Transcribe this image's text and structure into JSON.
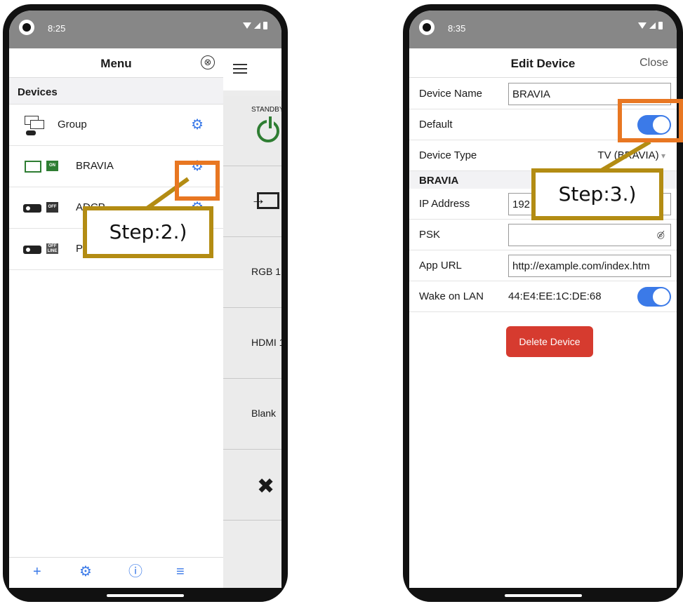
{
  "phone1": {
    "status_time": "8:25",
    "menu": {
      "title": "Menu",
      "close_glyph": "⊗",
      "section": "Devices",
      "items": [
        {
          "label": "Group",
          "icon": "group-icon"
        },
        {
          "label": "BRAVIA",
          "icon": "tv-icon",
          "state": "ON"
        },
        {
          "label": "ADCP",
          "icon": "projector-icon",
          "state": "OFF"
        },
        {
          "label": "P",
          "icon": "projector-icon",
          "state_line1": "OFF",
          "state_line2": "LINE"
        }
      ],
      "gear_glyph": "⚙",
      "bottom": {
        "add": "+",
        "settings": "⚙",
        "info": "ⓘ",
        "list": "≡"
      }
    },
    "remote": {
      "standby": "STANDBY",
      "buttons": [
        "RGB 1",
        "HDMI 1",
        "Blank"
      ]
    }
  },
  "phone2": {
    "status_time": "8:35",
    "header": {
      "title": "Edit Device",
      "close": "Close"
    },
    "fields": {
      "device_name_label": "Device Name",
      "device_name_value": "BRAVIA",
      "default_label": "Default",
      "default_on": true,
      "device_type_label": "Device Type",
      "device_type_value": "TV (BRAVIA)",
      "section": "BRAVIA",
      "ip_label": "IP Address",
      "ip_value": "192",
      "psk_label": "PSK",
      "psk_value": "",
      "app_url_label": "App URL",
      "app_url_value": "http://example.com/index.htm",
      "wol_label": "Wake on LAN",
      "wol_value": "44:E4:EE:1C:DE:68",
      "wol_on": true
    },
    "delete_label": "Delete Device"
  },
  "annotations": {
    "step2": "Step:2.)",
    "step3": "Step:3.)",
    "highlight_color": "#e87722",
    "callout_color": "#b38c13"
  }
}
